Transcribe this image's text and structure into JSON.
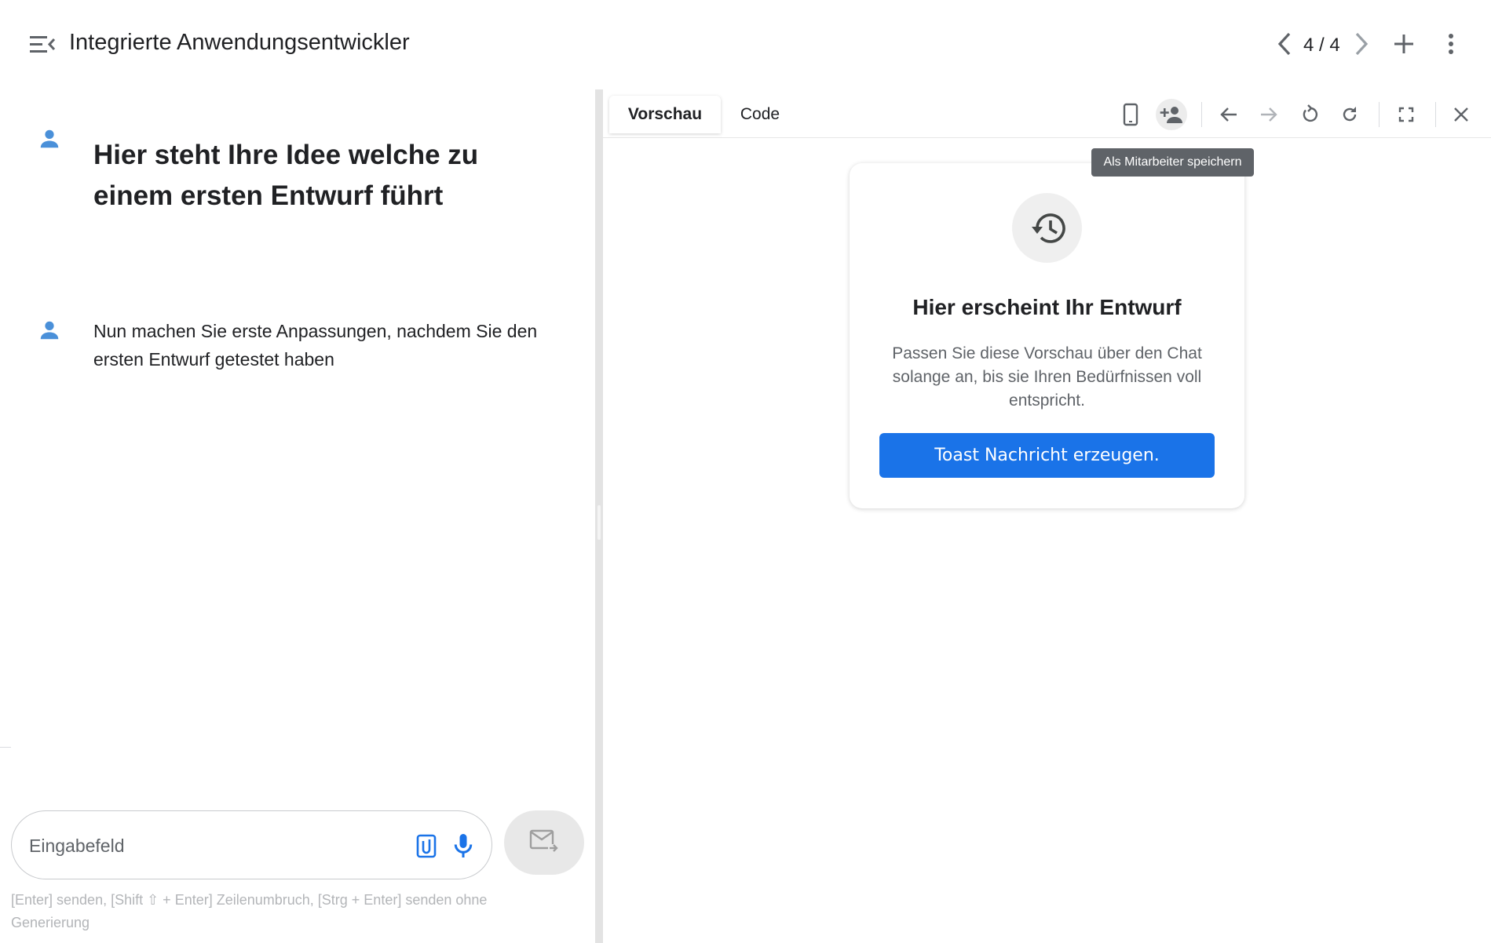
{
  "header": {
    "title": "Integrierte Anwendungsentwickler",
    "pager": "4 / 4"
  },
  "chat": {
    "messages": [
      {
        "text": "Hier steht Ihre Idee welche zu einem ersten Entwurf führt"
      },
      {
        "text": "Nun machen Sie erste Anpassungen, nachdem Sie den ersten Entwurf getestet haben"
      }
    ],
    "input": {
      "placeholder": "Eingabefeld",
      "value": ""
    },
    "hint": "[Enter] senden, [Shift ⇧ + Enter] Zeilenumbruch, [Strg + Enter] senden ohne Generierung"
  },
  "preview": {
    "tabs": [
      {
        "label": "Vorschau",
        "active": true
      },
      {
        "label": "Code",
        "active": false
      }
    ],
    "tooltip": "Als Mitarbeiter speichern",
    "card": {
      "title": "Hier erscheint Ihr Entwurf",
      "text": "Passen Sie diese Vorschau über den Chat solange an, bis sie Ihren Bedürfnissen voll entspricht.",
      "button_label": "Toast Nachricht erzeugen."
    }
  },
  "colors": {
    "accent": "#1a73e8",
    "user_icon": "#4a90d9",
    "text": "#202124",
    "muted": "#5f6368"
  },
  "icons": {
    "menu": "menu-collapse-icon",
    "prev": "chevron-left-icon",
    "next": "chevron-right-icon",
    "add": "plus-icon",
    "more": "more-vert-icon",
    "user": "person-icon",
    "attach": "attach-file-icon",
    "mic": "mic-icon",
    "send": "send-mail-icon",
    "phone": "smartphone-icon",
    "add_person": "person-add-icon",
    "back": "arrow-back-icon",
    "forward": "arrow-forward-icon",
    "reset": "restart-icon",
    "refresh": "refresh-icon",
    "fullscreen": "fullscreen-icon",
    "close": "close-icon",
    "history": "history-icon"
  }
}
